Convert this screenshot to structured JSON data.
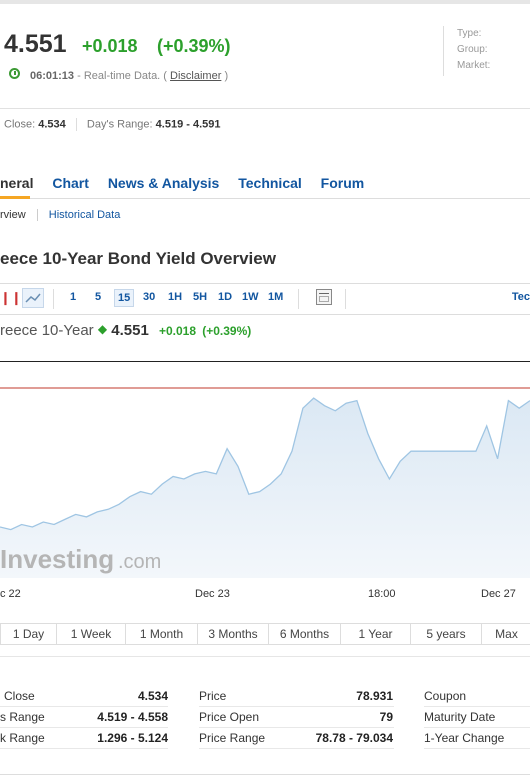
{
  "quote": {
    "price": "4.551",
    "change": "+0.018",
    "change_pct": "(+0.39%)",
    "time": "06:01:13",
    "realtime_text": "- Real-time Data. (",
    "disclaimer": "Disclaimer",
    "realtime_end": ")"
  },
  "meta": {
    "type": "Type:",
    "group": "Group:",
    "market": "Market:"
  },
  "summary": {
    "close_label": "Close:",
    "close_value": "4.534",
    "range_label": "Day's Range:",
    "range_value": "4.519 - 4.591"
  },
  "tabs": [
    "neral",
    "Chart",
    "News & Analysis",
    "Technical",
    "Forum"
  ],
  "subtabs": {
    "overview": "rview",
    "historical": "Historical Data"
  },
  "heading": "eece 10-Year Bond Yield Overview",
  "toolbar": {
    "intervals": [
      "1",
      "5",
      "15",
      "30",
      "1H",
      "5H",
      "1D",
      "1W",
      "1M"
    ],
    "selected": "15",
    "right": "Tec"
  },
  "chart_quote": {
    "name": "reece 10-Year",
    "price": "4.551",
    "change": "+0.018",
    "change_pct": "(+0.39%)"
  },
  "chart_data": {
    "type": "area",
    "x_ticks": [
      "c 22",
      "Dec 23",
      "18:00",
      "Dec 27"
    ],
    "watermark": "Investing",
    "watermark_suffix": ".com",
    "values": [
      4.536,
      4.535,
      4.537,
      4.536,
      4.538,
      4.537,
      4.539,
      4.541,
      4.54,
      4.542,
      4.543,
      4.545,
      4.548,
      4.55,
      4.549,
      4.553,
      4.556,
      4.555,
      4.557,
      4.558,
      4.557,
      4.567,
      4.56,
      4.549,
      4.55,
      4.553,
      4.557,
      4.566,
      4.583,
      4.587,
      4.584,
      4.582,
      4.585,
      4.586,
      4.573,
      4.563,
      4.555,
      4.562,
      4.566,
      4.566,
      4.566,
      4.566,
      4.566,
      4.566,
      4.566,
      4.576,
      4.563,
      4.586,
      4.583,
      4.586
    ],
    "ylim": [
      4.519,
      4.591
    ],
    "reference_line": 4.591
  },
  "periods": [
    "1 Day",
    "1 Week",
    "1 Month",
    "3 Months",
    "6 Months",
    "1 Year",
    "5 years",
    "Max"
  ],
  "stats": {
    "col1": [
      {
        "label": "Close",
        "value": "4.534"
      },
      {
        "label": "s Range",
        "value": "4.519 - 4.558"
      },
      {
        "label": "k Range",
        "value": "1.296 - 5.124"
      }
    ],
    "col2": [
      {
        "label": "Price",
        "value": "78.931"
      },
      {
        "label": "Price Open",
        "value": "79"
      },
      {
        "label": "Price Range",
        "value": "78.78 - 79.034"
      }
    ],
    "col3": [
      {
        "label": "Coupon"
      },
      {
        "label": "Maturity Date"
      },
      {
        "label": "1-Year Change"
      }
    ]
  },
  "colors": {
    "up": "#2ca02c",
    "link": "#1256a0",
    "chart_line": "#9fc5e3",
    "chart_fill": "#e6eff7",
    "ref_line": "#c0392b"
  }
}
